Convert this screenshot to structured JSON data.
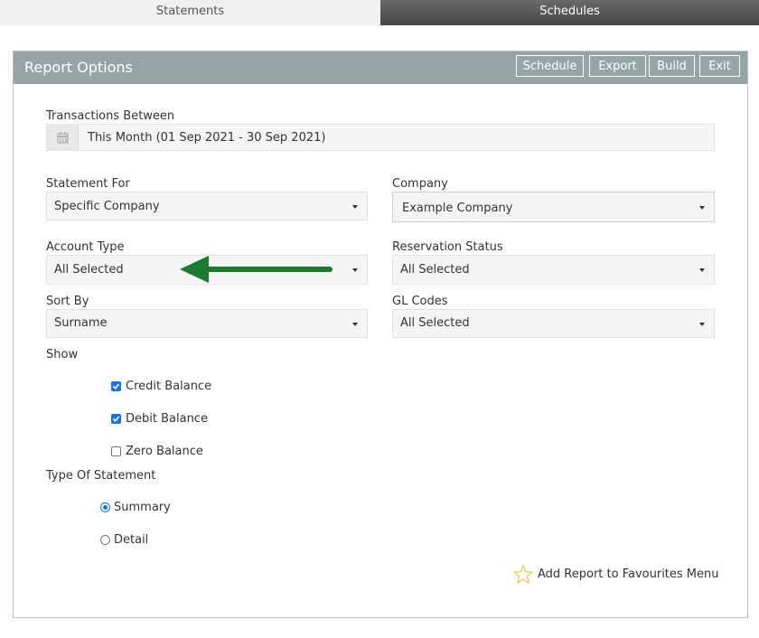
{
  "tabs": [
    {
      "label": "Statements",
      "active": false
    },
    {
      "label": "Schedules",
      "active": true
    }
  ],
  "panel": {
    "title": "Report Options",
    "buttons": {
      "schedule": "Schedule",
      "export": "Export",
      "build": "Build",
      "exit": "Exit"
    }
  },
  "form": {
    "transactions_between": {
      "label": "Transactions Between",
      "value": "This Month (01 Sep 2021 - 30 Sep 2021)",
      "icon": "calendar-icon"
    },
    "statement_for": {
      "label": "Statement For",
      "value": "Specific Company"
    },
    "company": {
      "label": "Company",
      "value": "Example Company"
    },
    "account_type": {
      "label": "Account Type",
      "value": "All Selected"
    },
    "reservation_status": {
      "label": "Reservation Status",
      "value": "All Selected"
    },
    "sort_by": {
      "label": "Sort By",
      "value": "Surname"
    },
    "gl_codes": {
      "label": "GL Codes",
      "value": "All Selected"
    },
    "show": {
      "label": "Show",
      "options": [
        {
          "label": "Credit Balance",
          "checked": true
        },
        {
          "label": "Debit Balance",
          "checked": true
        },
        {
          "label": "Zero Balance",
          "checked": false
        }
      ]
    },
    "type_of_statement": {
      "label": "Type Of Statement",
      "options": [
        {
          "label": "Summary",
          "selected": true
        },
        {
          "label": "Detail",
          "selected": false
        }
      ]
    }
  },
  "favourites": {
    "label": "Add Report to Favourites Menu",
    "icon": "star-outline-icon"
  },
  "annotation": {
    "icon": "green-arrow-pointer-icon",
    "color": "#1e7a2e"
  },
  "colors": {
    "header": "#95a5a6",
    "accent": "#1a73e8",
    "tab_active_bg": "#555555",
    "tab_inactive_bg": "#f0f0f0"
  }
}
